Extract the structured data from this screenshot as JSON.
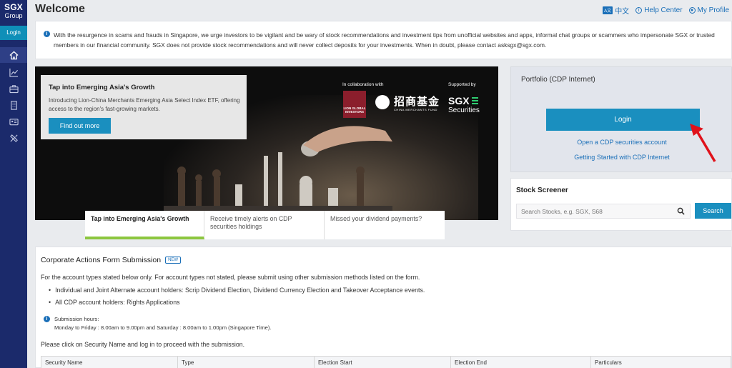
{
  "sidebar": {
    "logo_line1": "SGX",
    "logo_line2": "Group",
    "login_label": "Login",
    "icons": [
      "home-icon",
      "chart-icon",
      "briefcase-icon",
      "building-icon",
      "id-card-icon",
      "tools-icon"
    ]
  },
  "header": {
    "title": "Welcome",
    "lang_badge": "A文",
    "lang_label": "中文",
    "help_label": "Help Center",
    "profile_label": "My Profile"
  },
  "notice": {
    "text": "With the resurgence in scams and frauds in Singapore, we urge investors to be vigilant and be wary of stock recommendations and investment tips from unofficial websites and apps, informal chat groups or scammers who impersonate SGX or trusted members in our financial community. SGX does not provide stock recommendations and will never collect deposits for your investments. When in doubt, please contact asksgx@sgx.com."
  },
  "hero": {
    "promo_title": "Tap into Emerging Asia's Growth",
    "promo_text": "Introducing Lion-China Merchants Emerging Asia Select Index ETF, offering access to the region's fast-growing markets.",
    "promo_button": "Find out more",
    "collab_label": "In collaboration with",
    "supported_label": "Supported by",
    "lion_logo": "LION GLOBAL INVESTORS",
    "cm_logo_text": "招商基金",
    "cm_logo_sub": "CHINA MERCHANTS FUND",
    "sgx_logo_line1": "SGX",
    "sgx_logo_line2": "Securities",
    "tabs": [
      {
        "label": "Tap into Emerging Asia's Growth"
      },
      {
        "label": "Receive timely alerts on CDP securities holdings"
      },
      {
        "label": "Missed your dividend payments?"
      }
    ]
  },
  "portfolio": {
    "title": "Portfolio (CDP Internet)",
    "login_button": "Login",
    "link_open": "Open a CDP securities account",
    "link_started": "Getting Started with CDP Internet"
  },
  "screener": {
    "title": "Stock Screener",
    "placeholder": "Search Stocks, e.g. SGX, S68",
    "button": "Search"
  },
  "corporate": {
    "title": "Corporate Actions Form Submission",
    "badge": "NEW",
    "intro": "For the account types stated below only. For account types not stated, please submit using other submission methods listed on the form.",
    "bullets": [
      "Individual and Joint Alternate account holders: Scrip Dividend Election, Dividend Currency Election and Takeover Acceptance events.",
      "All CDP account holders: Rights Applications"
    ],
    "hours_label": "Submission hours:",
    "hours_text": "Monday to Friday : 8.00am to 9.00pm and Saturday : 8.00am to 1.00pm (Singapore Time).",
    "instruction": "Please click on Security Name and log in to proceed with the submission.",
    "columns": [
      "Security Name",
      "Type",
      "Election Start",
      "Election End",
      "Particulars"
    ]
  },
  "colors": {
    "sidebar": "#1b2a6b",
    "accent": "#1a8fbf",
    "link": "#1a6fb8",
    "tab_active": "#8cc63f",
    "arrow": "#e0121b"
  }
}
